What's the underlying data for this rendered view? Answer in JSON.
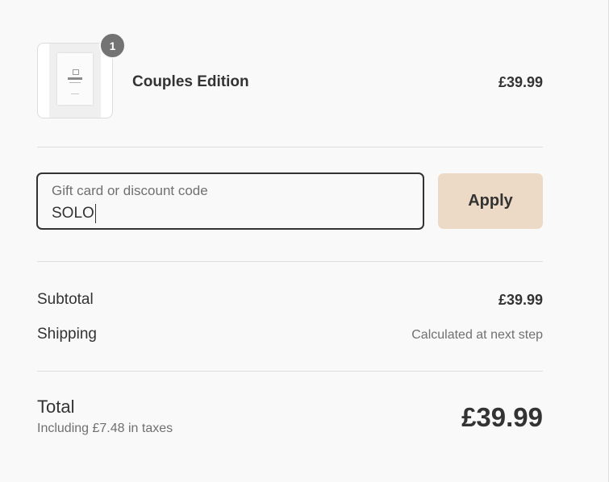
{
  "line_item": {
    "quantity": "1",
    "name": "Couples Edition",
    "price": "£39.99"
  },
  "discount": {
    "label": "Gift card or discount code",
    "value": "SOLO",
    "apply_label": "Apply"
  },
  "summary": {
    "subtotal_label": "Subtotal",
    "subtotal_value": "£39.99",
    "shipping_label": "Shipping",
    "shipping_value": "Calculated at next step",
    "total_label": "Total",
    "tax_note": "Including £7.48 in taxes",
    "total_value": "£39.99"
  },
  "colors": {
    "background": "#f9f9f9",
    "apply_button": "#ecd9c6",
    "badge": "#737373",
    "text": "#333333",
    "muted_text": "#707070"
  }
}
